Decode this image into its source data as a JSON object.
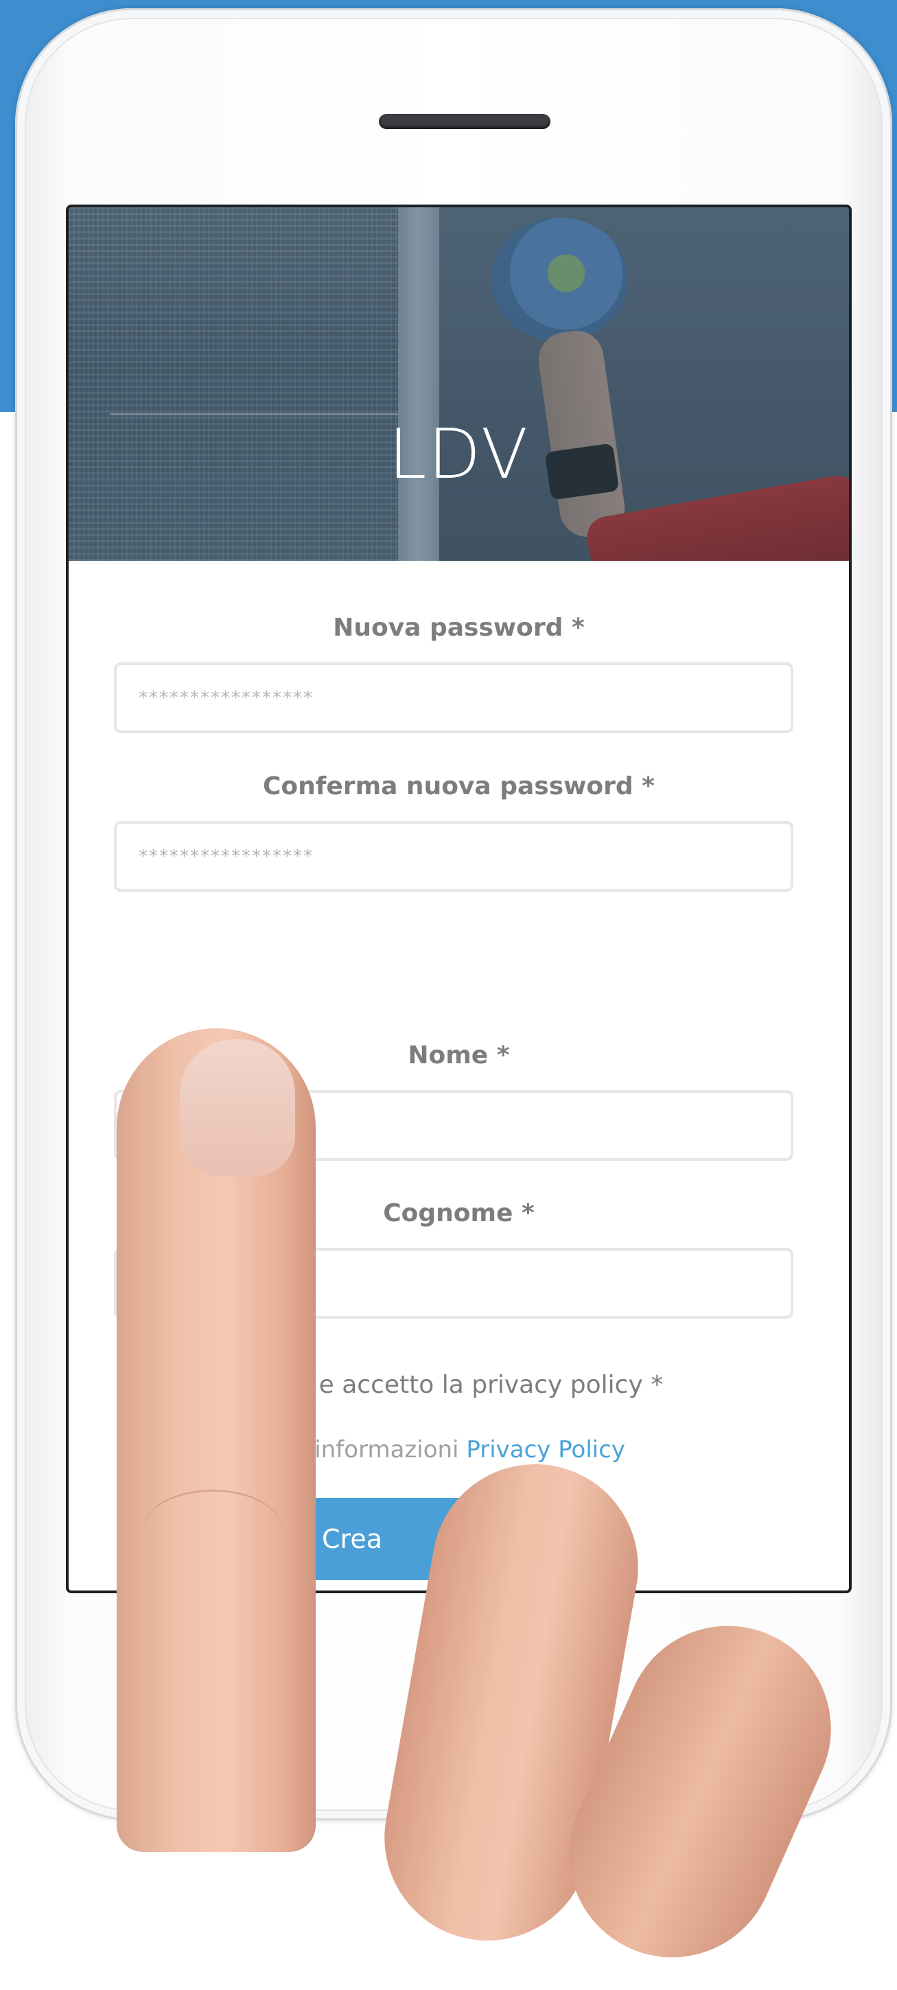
{
  "header": {
    "app_title": "LDV"
  },
  "form": {
    "new_password": {
      "label": "Nuova password *",
      "placeholder": "*****************"
    },
    "confirm_password": {
      "label": "Conferma nuova password *",
      "placeholder": "*****************"
    },
    "first_name": {
      "label": "Nome *",
      "value": ""
    },
    "last_name": {
      "label": "Cognome *",
      "value": ""
    },
    "privacy_checkbox_label": "letto e accetto la privacy policy *",
    "privacy_info_prefix": "ù informazioni ",
    "privacy_link_text": "Privacy Policy",
    "submit_label": "Crea"
  },
  "colors": {
    "background_band": "#3d8dcf",
    "accent": "#4a9fd8",
    "link": "#4aa3d6",
    "label_text": "#7d7d7d"
  }
}
